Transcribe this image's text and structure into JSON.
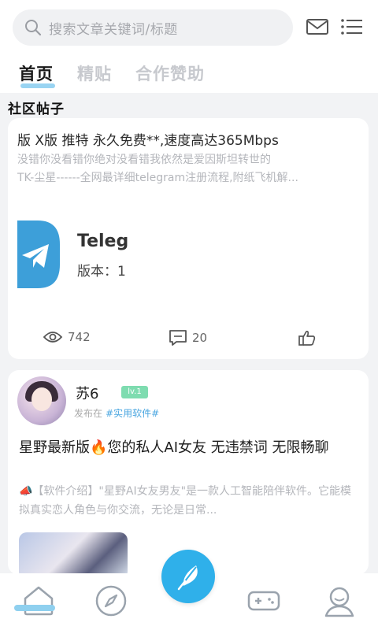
{
  "search": {
    "placeholder": "搜索文章关键词/标题"
  },
  "tabs": [
    {
      "label": "首页",
      "active": true
    },
    {
      "label": "精贴",
      "active": false
    },
    {
      "label": "合作赞助",
      "active": false
    }
  ],
  "section": {
    "title": "社区帖子"
  },
  "post1": {
    "headline": "版 X版 推特 永久免费**,速度高达365Mbps",
    "desc_lines": [
      "没错你没看错你绝对没看错我依然是爱因斯坦转世的",
      "TK-尘星------全网最详细telegram注册流程,附纸飞机解..."
    ],
    "app_name": "Telegr",
    "app_version": "版本：1",
    "views": "742",
    "comments": "20"
  },
  "post2": {
    "username": "苏6",
    "badge": "lv.1",
    "posted_prefix": "发布在",
    "category_tag": "#实用软件#",
    "title": "星野最新版🔥您的私人AI女友 无违禁词 无限畅聊",
    "desc": "📣【软件介绍】\"星野AI女友男友\"是一款人工智能陪伴软件。它能模拟真实恋人角色与你交流，无论是日常..."
  },
  "colors": {
    "accent": "#2fb0ea",
    "tab_underline": "#7fc9ef",
    "tag": "#4aa6e0",
    "badge": "#7edcb0"
  },
  "icons": [
    "search-icon",
    "mail-icon",
    "menu-icon",
    "telegram-icon",
    "eye-icon",
    "comment-icon",
    "thumbs-up-icon",
    "home-icon",
    "compass-icon",
    "feather-icon",
    "gamepad-icon",
    "user-icon"
  ]
}
